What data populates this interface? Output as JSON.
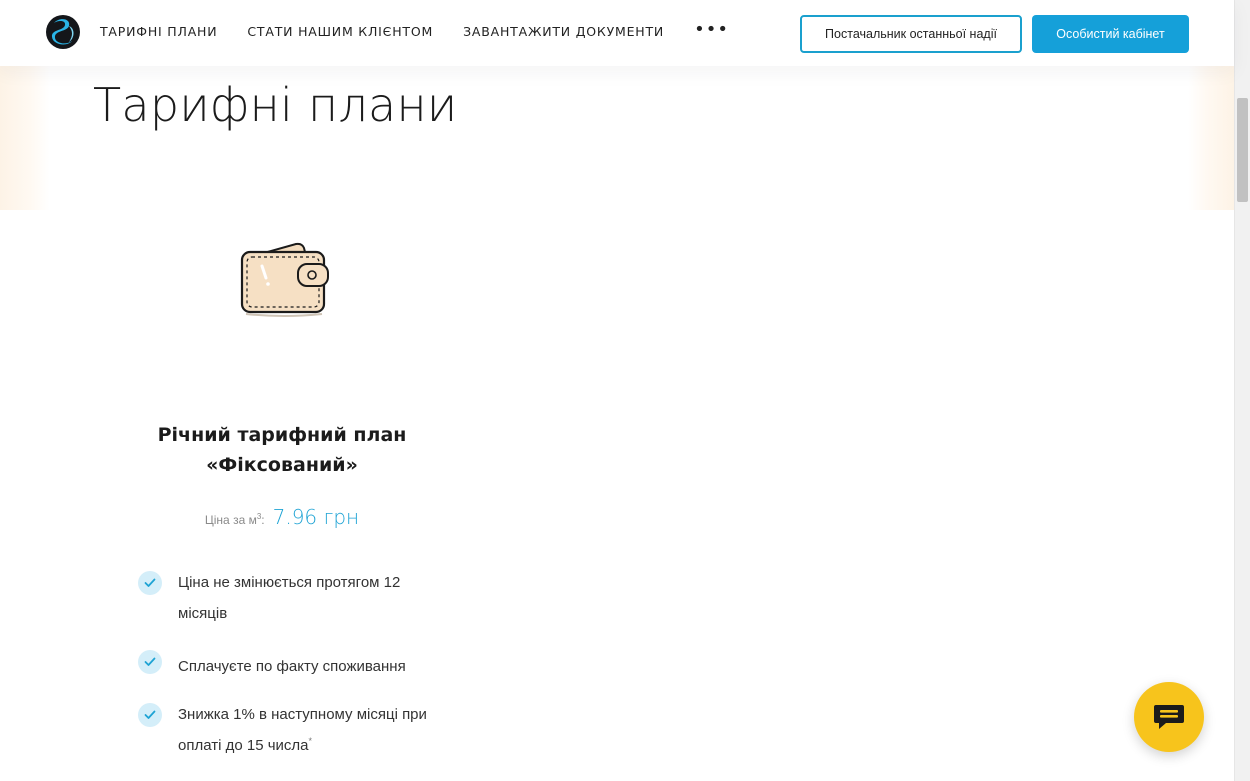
{
  "header": {
    "nav": [
      {
        "label": "ТАРИФНІ ПЛАНИ"
      },
      {
        "label": "СТАТИ НАШИМ КЛІЄНТОМ"
      },
      {
        "label": "ЗАВАНТАЖИТИ ДОКУМЕНТИ"
      }
    ],
    "more_label": "•••",
    "supplier_button": "Постачальник останньої надії",
    "account_button": "Особистий кабінет",
    "logo_icon": "brand-logo-icon",
    "colors": {
      "accent": "#15a0d9",
      "outline": "#1aa0ce"
    }
  },
  "page": {
    "title": "Тарифні плани"
  },
  "plan": {
    "image_icon": "wallet-icon",
    "title_line1": "Річний тарифний план",
    "title_line2": "«Фіксований»",
    "price_label": "Ціна за м",
    "price_label_sup": "3",
    "price_label_colon": ":",
    "price_value": "7.96 грн",
    "features": [
      {
        "text": "Ціна не змінюється протягом 12 місяців",
        "note": ""
      },
      {
        "text": "Сплачуєте по факту споживання",
        "note": ""
      },
      {
        "text": "Знижка 1% в наступному місяці при оплаті до 15 числа",
        "note": "*"
      }
    ],
    "check_icon": "check-icon",
    "colors": {
      "price": "#1ea3d4",
      "check_bg": "#d4eef9"
    }
  },
  "chat": {
    "icon": "chat-icon",
    "color": "#f7c41c"
  }
}
